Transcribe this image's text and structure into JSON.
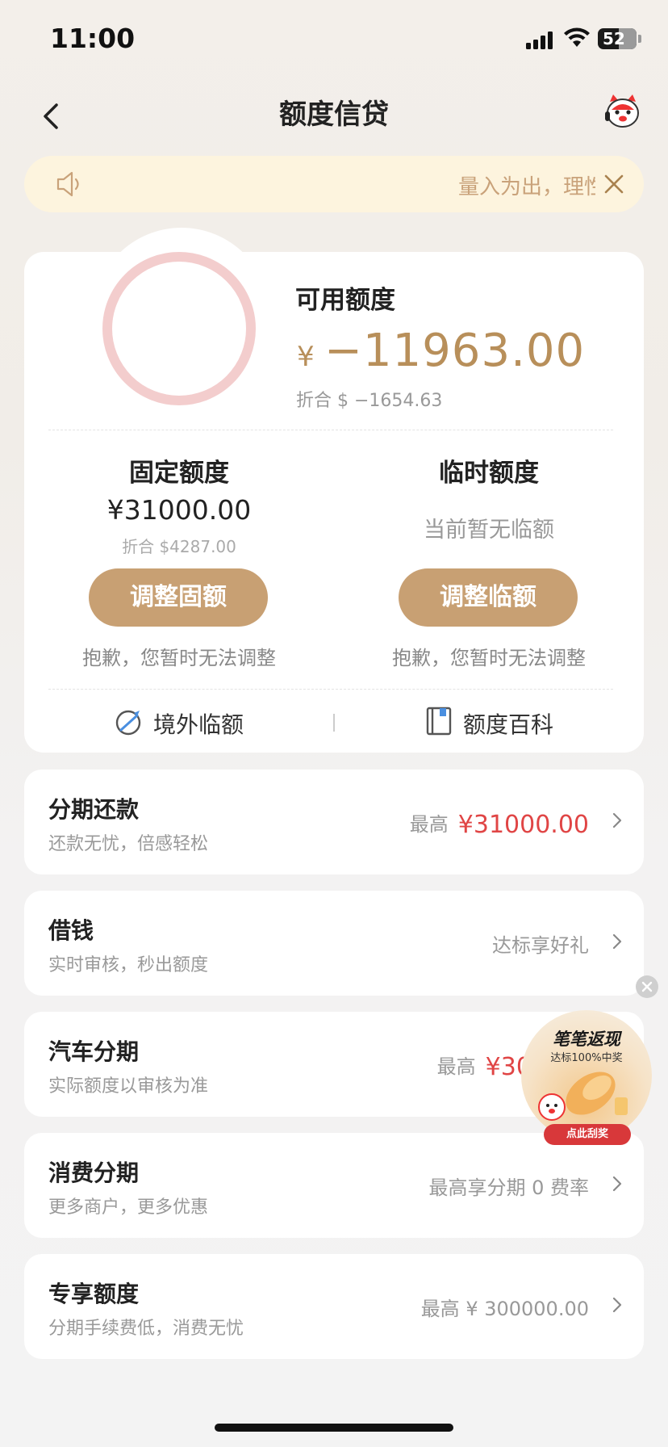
{
  "status_bar": {
    "time": "11:00",
    "battery": "52"
  },
  "header": {
    "title": "额度信贷"
  },
  "notice": {
    "text": "量入为出，理性消费"
  },
  "quota": {
    "available_label": "可用额度",
    "currency_symbol": "¥",
    "available_value": "−11963.00",
    "available_usd": "折合 $ −1654.63",
    "fixed": {
      "title": "固定额度",
      "value": "¥31000.00",
      "usd": "折合 $4287.00",
      "button": "调整固额",
      "note": "抱歉，您暂时无法调整"
    },
    "temporary": {
      "title": "临时额度",
      "empty_text": "当前暂无临额",
      "button": "调整临额",
      "note": "抱歉，您暂时无法调整"
    },
    "links": {
      "overseas": "境外临额",
      "wiki": "额度百科"
    }
  },
  "services": [
    {
      "title": "分期还款",
      "subtitle": "还款无忧，倍感轻松",
      "right_prefix": "最高",
      "right_amount": "¥31000.00"
    },
    {
      "title": "借钱",
      "subtitle": "实时审核，秒出额度",
      "right_prefix": "达标享好礼",
      "right_amount": ""
    },
    {
      "title": "汽车分期",
      "subtitle": "实际额度以审核为准",
      "right_prefix": "最高",
      "right_amount": "¥304"
    },
    {
      "title": "消费分期",
      "subtitle": "更多商户，更多优惠",
      "right_prefix": "最高享分期 0 费率",
      "right_amount": ""
    },
    {
      "title": "专享额度",
      "subtitle": "分期手续费低，消费无忧",
      "right_prefix": "最高 ¥ 300000.00",
      "right_amount": ""
    }
  ],
  "promo": {
    "title": "笔笔返现",
    "subtitle": "达标100%中奖",
    "button": "点此刮奖"
  },
  "colors": {
    "accent": "#c8a073",
    "amount_gold": "#b88f5a",
    "amount_red": "#e04545",
    "notice_bg": "#fdf4de"
  }
}
